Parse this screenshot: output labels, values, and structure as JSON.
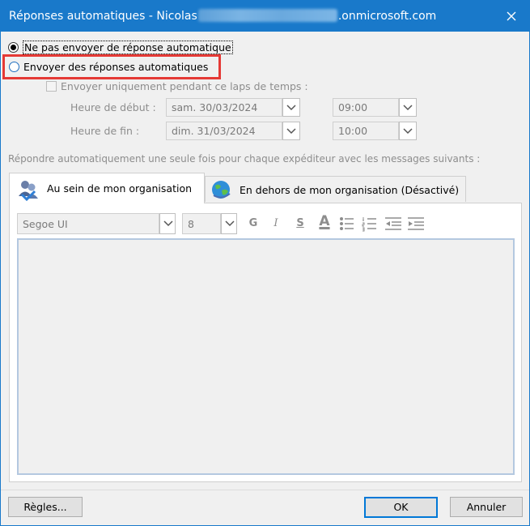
{
  "window": {
    "title_prefix": "Réponses automatiques - Nicolas",
    "title_suffix": ".onmicrosoft.com"
  },
  "options": {
    "no_reply": "Ne pas envoyer de réponse automatique",
    "send_replies": "Envoyer des réponses automatiques",
    "only_during": "Envoyer uniquement pendant ce laps de temps :"
  },
  "schedule": {
    "start_label": "Heure de début :",
    "end_label": "Heure de fin :",
    "start_date": "sam. 30/03/2024",
    "start_time": "09:00",
    "end_date": "dim. 31/03/2024",
    "end_time": "10:00"
  },
  "instructions": "Répondre automatiquement une seule fois pour chaque expéditeur avec les messages suivants :",
  "tabs": [
    {
      "label": "Au sein de mon organisation"
    },
    {
      "label": "En dehors de mon organisation (Désactivé)"
    }
  ],
  "toolbar": {
    "font_name": "Segoe UI",
    "font_size": "8",
    "bold": "G",
    "italic": "I",
    "underline": "S",
    "font_color": "A"
  },
  "buttons": {
    "rules": "Règles...",
    "ok": "OK",
    "cancel": "Annuler"
  },
  "colors": {
    "titlebar": "#1979ca",
    "highlight": "#e53935",
    "default_button_border": "#0078d7"
  }
}
